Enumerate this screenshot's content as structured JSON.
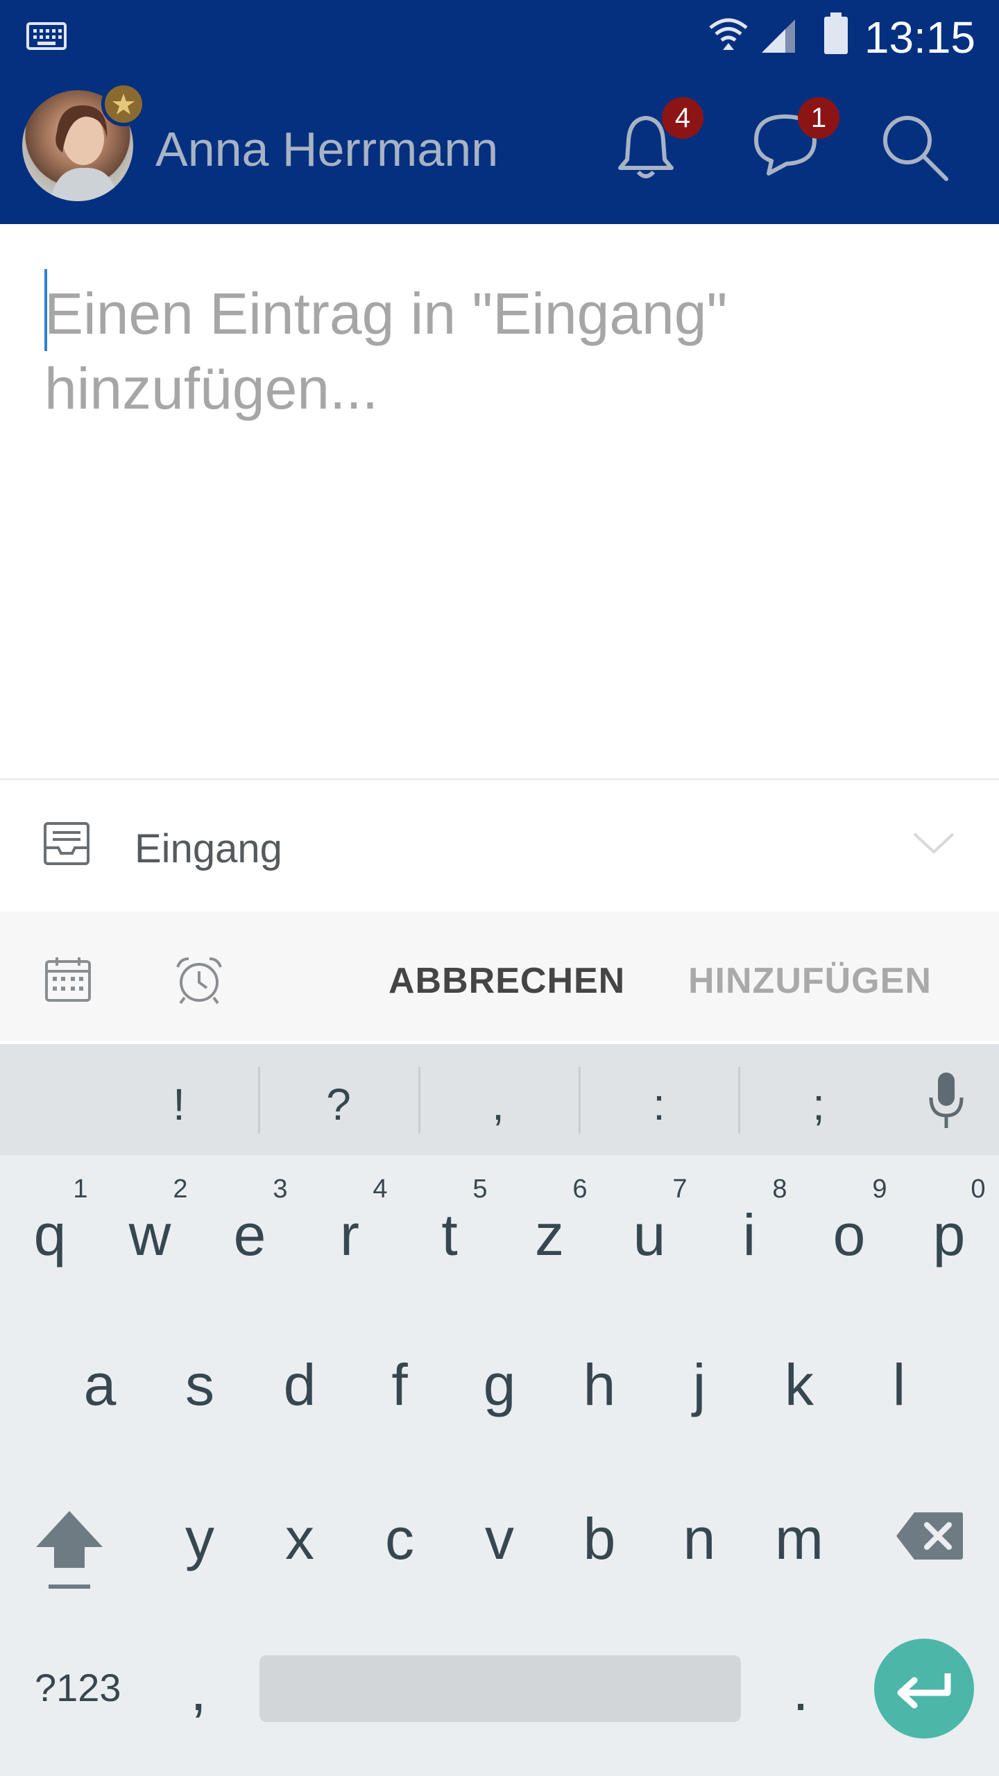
{
  "status_bar": {
    "time": "13:15",
    "icons": [
      "keyboard-icon",
      "wifi-icon",
      "signal-icon",
      "battery-icon"
    ]
  },
  "header": {
    "user_name": "Anna Herrmann",
    "notifications_count": "4",
    "messages_count": "1",
    "icons": [
      "bell-icon",
      "chat-icon",
      "search-icon"
    ]
  },
  "composer": {
    "placeholder": "Einen Eintrag in \"Eingang\" hinzufügen..."
  },
  "list_selector": {
    "label": "Eingang",
    "icons": [
      "inbox-icon",
      "chevron-down-icon"
    ]
  },
  "actions": {
    "cancel_label": "ABBRECHEN",
    "add_label": "HINZUFÜGEN",
    "icons": [
      "calendar-icon",
      "alarm-icon"
    ]
  },
  "keyboard": {
    "suggestions": [
      "!",
      "?",
      ",",
      ":",
      ";"
    ],
    "row1": [
      "q",
      "w",
      "e",
      "r",
      "t",
      "z",
      "u",
      "i",
      "o",
      "p"
    ],
    "row1_hints": [
      "1",
      "2",
      "3",
      "4",
      "5",
      "6",
      "7",
      "8",
      "9",
      "0"
    ],
    "row2": [
      "a",
      "s",
      "d",
      "f",
      "g",
      "h",
      "j",
      "k",
      "l"
    ],
    "row3": [
      "y",
      "x",
      "c",
      "v",
      "b",
      "n",
      "m"
    ],
    "symbols_label": "?123",
    "comma": ",",
    "period": ".",
    "icons": [
      "mic-icon",
      "shift-icon",
      "backspace-icon",
      "enter-icon"
    ]
  },
  "colors": {
    "header_bg": "#04307f",
    "badge": "#8c1414",
    "enter_key": "#4cb6a8"
  }
}
